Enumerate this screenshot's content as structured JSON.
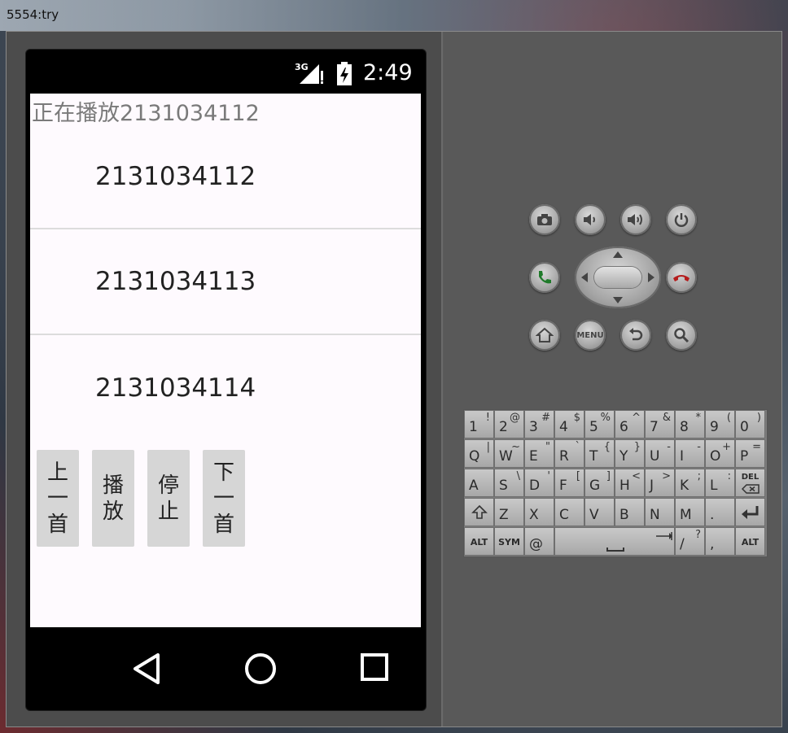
{
  "window": {
    "title": "5554:try"
  },
  "status_bar": {
    "network": "3G",
    "time": "2:49"
  },
  "app": {
    "now_playing": "正在播放2131034112",
    "songs": [
      "2131034112",
      "2131034113",
      "2131034114"
    ],
    "buttons": {
      "prev": "上一首",
      "play": "播放",
      "stop": "停止",
      "next": "下一首"
    }
  },
  "navbar": {
    "back": "back-icon",
    "home": "home-icon",
    "recents": "recents-icon"
  },
  "hardware": {
    "row1": [
      "camera-icon",
      "volume-down-icon",
      "volume-up-icon",
      "power-icon"
    ],
    "menu_label": "MENU"
  },
  "keyboard": {
    "row1": [
      [
        "1",
        "!"
      ],
      [
        "2",
        "@"
      ],
      [
        "3",
        "#"
      ],
      [
        "4",
        "$"
      ],
      [
        "5",
        "%"
      ],
      [
        "6",
        "^"
      ],
      [
        "7",
        "&"
      ],
      [
        "8",
        "*"
      ],
      [
        "9",
        "("
      ],
      [
        "0",
        ")"
      ]
    ],
    "row2": [
      [
        "Q",
        "|"
      ],
      [
        "W",
        "~"
      ],
      [
        "E",
        "\""
      ],
      [
        "R",
        "`"
      ],
      [
        "T",
        "{"
      ],
      [
        "Y",
        "}"
      ],
      [
        "U",
        "-"
      ],
      [
        "I",
        "-"
      ],
      [
        "O",
        "+"
      ],
      [
        "P",
        "="
      ]
    ],
    "row3": [
      [
        "A",
        ""
      ],
      [
        "S",
        "\\"
      ],
      [
        "D",
        "'"
      ],
      [
        "F",
        "["
      ],
      [
        "G",
        "]"
      ],
      [
        "H",
        "<"
      ],
      [
        "J",
        ">"
      ],
      [
        "K",
        ";"
      ],
      [
        "L",
        ":"
      ]
    ],
    "row3_del": "DEL",
    "row4": [
      "Z",
      "X",
      "C",
      "V",
      "B",
      "N",
      "M",
      "."
    ],
    "alt": "ALT",
    "sym": "SYM",
    "at": "@",
    "slash": "/",
    "question": "?",
    "comma": ","
  }
}
